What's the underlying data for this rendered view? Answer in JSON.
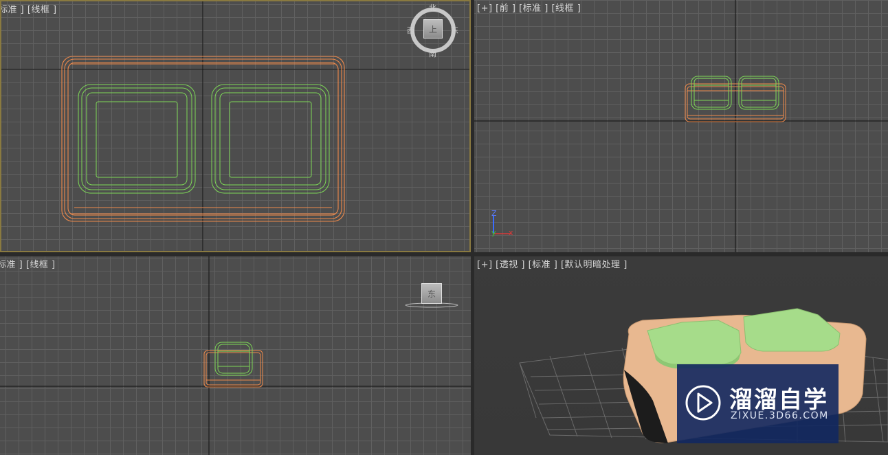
{
  "viewports": {
    "top": {
      "label": "标准 ] [线框 ]"
    },
    "front": {
      "label": "[+] [前 ] [标准 ] [线框 ]"
    },
    "left": {
      "label": "标准 ] [线框 ]"
    },
    "perspective": {
      "label": "[+] [透视 ] [标准 ] [默认明暗处理 ]"
    }
  },
  "viewcube": {
    "top": {
      "north": "北",
      "south": "南",
      "east": "东",
      "west": "西",
      "face": "上"
    },
    "left": {
      "face": "东"
    }
  },
  "axis_gizmo": {
    "z": "Z",
    "y": "y",
    "x": "x"
  },
  "watermark": {
    "title": "溜溜自学",
    "url": "ZIXUE.3D66.COM"
  },
  "colors": {
    "viewport_bg": "#4d4d4d",
    "grid_line": "#606060",
    "base_wire": "#f08a4b",
    "cushion_wire": "#7ed957",
    "active_border": "#8a7a40",
    "base_shaded": "#e8b890",
    "cushion_shaded": "#a6dc8a"
  }
}
